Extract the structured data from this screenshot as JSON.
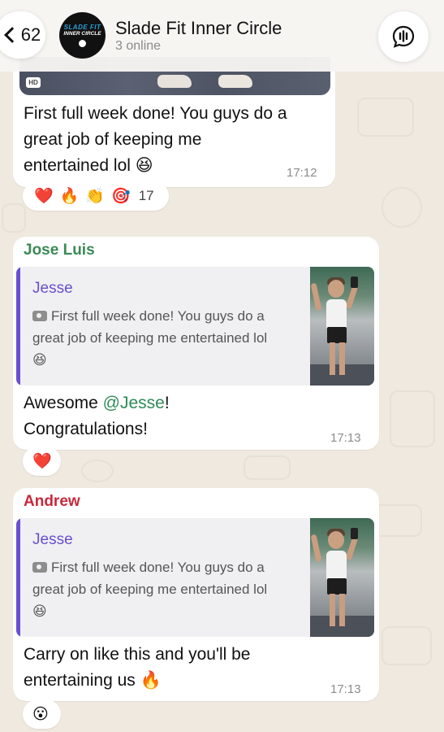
{
  "header": {
    "back_count": "62",
    "group_logo_line1": "SLADE FIT",
    "group_logo_line2": "INNER CIRCLE",
    "group_name": "Slade Fit Inner Circle",
    "status": "3 online"
  },
  "messages": [
    {
      "image_badge": "HD",
      "text_line1": "First full week done! You guys do a",
      "text_line2": "great job of keeping me",
      "text_line3": "entertained lol 😆",
      "time": "17:12",
      "reactions": [
        "❤️",
        "🔥",
        "👏",
        "🎯"
      ],
      "reaction_count": "17"
    },
    {
      "sender": "Jose Luis",
      "sender_color": "#3a8a55",
      "quote_author": "Jesse",
      "quote_line1": "First full week done! You guys do a",
      "quote_line2": "great job of keeping me entertained lol",
      "quote_line3": "😆",
      "text_prefix": "Awesome ",
      "mention": "@Jesse",
      "text_suffix": "!",
      "text_line2": "Congratulations!",
      "time": "17:13",
      "reactions": [
        "❤️"
      ]
    },
    {
      "sender": "Andrew",
      "sender_color": "#c8283c",
      "quote_author": "Jesse",
      "quote_line1": "First full week done! You guys do a",
      "quote_line2": "great job of keeping me entertained lol",
      "quote_line3": "😆",
      "text_line1": "Carry on like this and you'll be",
      "text_line2": "entertaining us 🔥",
      "time": "17:13",
      "reactions": [
        "😮"
      ]
    }
  ],
  "colors": {
    "quote_author": "#6a4fd1",
    "quote_bar": "#6a4fd1",
    "chat_background": "#efe9df"
  }
}
